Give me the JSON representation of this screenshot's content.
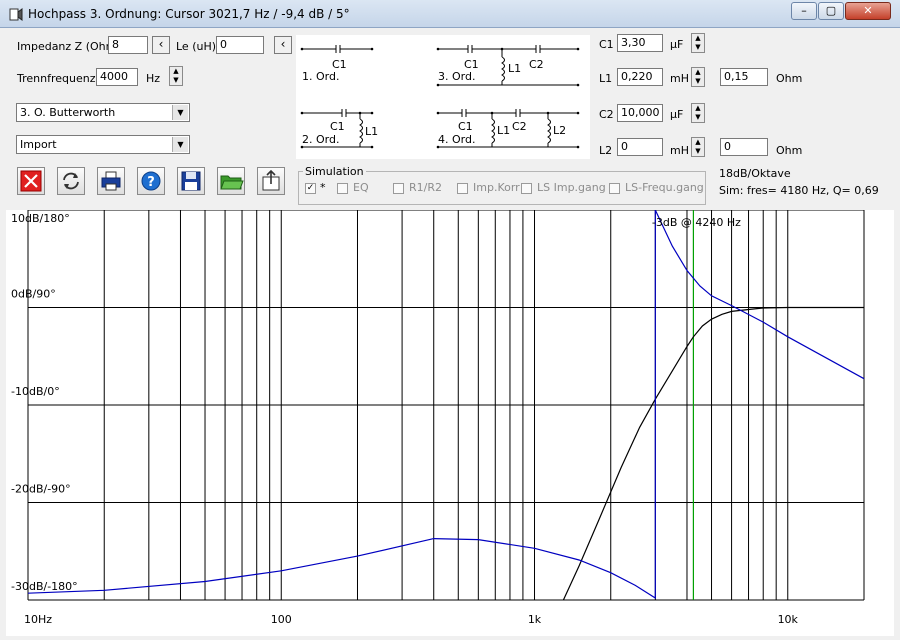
{
  "window": {
    "title": "Hochpass 3. Ordnung: Cursor 3021,7 Hz / -9,4 dB  / 5°",
    "minimize_glyph": "–",
    "maximize_glyph": "▢",
    "close_glyph": "✕"
  },
  "inputs": {
    "impedance_label": "Impedanz Z (Ohm)",
    "impedance_value": "8",
    "le_label": "Le (uH)",
    "le_value": "0",
    "crossover_label": "Trennfrequenz f",
    "crossover_value": "4000",
    "crossover_unit": "Hz",
    "filter_type": "3. O. Butterworth",
    "import_value": "Import"
  },
  "schematics": [
    {
      "name": "1. Ord.",
      "parts": [
        "C1"
      ]
    },
    {
      "name": "2. Ord.",
      "parts": [
        "C1",
        "L1"
      ]
    },
    {
      "name": "3. Ord.",
      "parts": [
        "C1",
        "L1",
        "C2"
      ]
    },
    {
      "name": "4. Ord.",
      "parts": [
        "C1",
        "L1",
        "C2",
        "L2"
      ]
    }
  ],
  "components": {
    "c1": {
      "label": "C1",
      "value": "3,30",
      "unit": "µF"
    },
    "l1": {
      "label": "L1",
      "value": "0,220",
      "unit": "mH",
      "r_value": "0,15",
      "r_unit": "Ohm"
    },
    "c2": {
      "label": "C2",
      "value": "10,000",
      "unit": "µF"
    },
    "l2": {
      "label": "L2",
      "value": "0",
      "unit": "mH",
      "r_value": "0",
      "r_unit": "Ohm"
    }
  },
  "toolbar": {
    "icons": [
      "close-icon",
      "refresh-icon",
      "print-icon",
      "help-icon",
      "save-icon",
      "open-folder-icon",
      "export-icon"
    ],
    "colors": {
      "close": "#e02020",
      "help": "#1f6fd0",
      "save": "#1a3f9a",
      "folder": "#3a9a2a"
    }
  },
  "simulation": {
    "label": "Simulation",
    "options": [
      {
        "label": "*",
        "checked": true
      },
      {
        "label": "EQ",
        "checked": false
      },
      {
        "label": "R1/R2",
        "checked": false
      },
      {
        "label": "Imp.Korr",
        "checked": false
      },
      {
        "label": "LS Imp.gang",
        "checked": false
      },
      {
        "label": "LS-Frequ.gang",
        "checked": false
      }
    ]
  },
  "info": {
    "slope": "18dB/Oktave",
    "sim": "Sim: fres= 4180 Hz, Q= 0,69"
  },
  "chart_data": {
    "type": "line",
    "x_scale": "log",
    "xlim": [
      10,
      20000
    ],
    "ylim": [
      -30,
      10
    ],
    "y_ticks": [
      {
        "value": 10,
        "label": "10dB/180°"
      },
      {
        "value": 0,
        "label": "0dB/90°"
      },
      {
        "value": -10,
        "label": "-10dB/0°"
      },
      {
        "value": -20,
        "label": "-20dB/-90°"
      },
      {
        "value": -30,
        "label": "-30dB/-180°"
      }
    ],
    "x_ticks": [
      {
        "value": 10,
        "label": "10Hz"
      },
      {
        "value": 100,
        "label": "100"
      },
      {
        "value": 1000,
        "label": "1k"
      },
      {
        "value": 10000,
        "label": "10k"
      }
    ],
    "annotation": "-3dB @ 4240 Hz",
    "marker_frequency": 4240,
    "colors": {
      "magnitude": "#000000",
      "phase": "#0000c0",
      "marker": "#00a000",
      "grid": "#000000"
    },
    "series": [
      {
        "type": "magnitude",
        "x": [
          1300,
          1500,
          1800,
          2200,
          2600,
          3000,
          3500,
          4000,
          4240,
          4600,
          5000,
          5500,
          6000,
          7000,
          8000,
          10000,
          20000
        ],
        "y": [
          -30,
          -26.5,
          -21.7,
          -16.4,
          -12.3,
          -9.4,
          -6.5,
          -4.0,
          -3.0,
          -1.9,
          -1.2,
          -0.7,
          -0.4,
          -0.2,
          -0.05,
          0,
          0
        ]
      },
      {
        "type": "phase",
        "x": [
          10,
          20,
          50,
          100,
          200,
          400,
          600,
          1000,
          1500,
          2000,
          2500,
          3000,
          3000,
          3500,
          4000,
          4500,
          5000,
          6000,
          8000,
          10000,
          20000
        ],
        "y": [
          -29.3,
          -29.0,
          -28.1,
          -27.0,
          -25.5,
          -23.7,
          -23.8,
          -24.7,
          -25.9,
          -27.2,
          -28.5,
          -29.8,
          10,
          6.3,
          3.8,
          2.2,
          1.2,
          0.2,
          -1.5,
          -3.0,
          -7.3
        ]
      }
    ]
  }
}
